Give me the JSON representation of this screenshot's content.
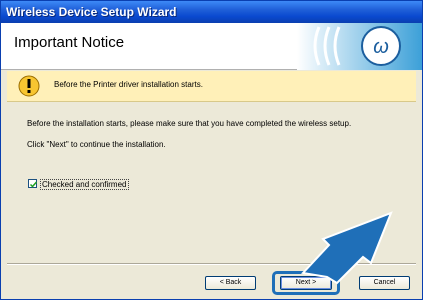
{
  "window": {
    "title": "Wireless Device Setup Wizard"
  },
  "header": {
    "title": "Important Notice",
    "logo_icon": "wireless-signal-icon"
  },
  "banner": {
    "icon": "warning-icon",
    "text": "Before the Printer driver installation starts."
  },
  "body": {
    "line1": "Before the installation starts, please make sure that you have completed the wireless setup.",
    "line2": "Click \"Next\" to continue the installation."
  },
  "checkbox": {
    "label": "Checked and confirmed",
    "checked": true
  },
  "buttons": {
    "back": "< Back",
    "next": "Next >",
    "cancel": "Cancel"
  },
  "colors": {
    "titlebar": "#0a49d0",
    "banner": "#fff0b8",
    "highlight": "#1f6fb8"
  }
}
